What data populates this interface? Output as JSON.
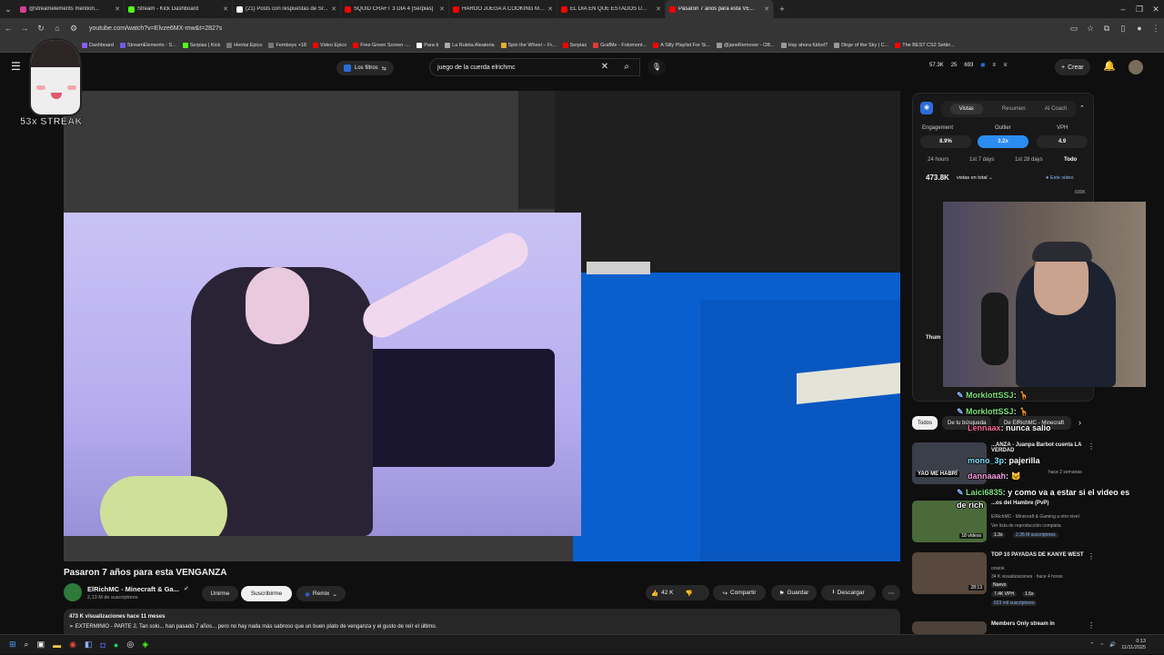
{
  "tabs": [
    {
      "label": "@streamelements mention...",
      "color": "#d63e8f",
      "active": false
    },
    {
      "label": "Stream - Kick Dashboard",
      "color": "#53fc18",
      "active": false
    },
    {
      "label": "(21) Posts con respuestas de Sr...",
      "color": "#ffffff",
      "active": false
    },
    {
      "label": "SQUID CRAFT 3 DIA 4 [Serpias]",
      "color": "#ff0000",
      "active": false
    },
    {
      "label": "HAROO JUEGA A COOKING MA...",
      "color": "#ff0000",
      "active": false
    },
    {
      "label": "EL DÍA EN QUE ESTADOS U...",
      "color": "#ff0000",
      "active": false
    },
    {
      "label": "Pasaron 7 años para esta VE...",
      "color": "#ff0000",
      "active": true
    }
  ],
  "address": {
    "url": "youtube.com/watch?v=Elvze6MX-mw&t=2827s"
  },
  "bookmarks": [
    "Dashboard",
    "StreamElements - S...",
    "Serpias | Kick",
    "Hentai Epico",
    "Femboys +18",
    "Video Epico",
    "Free Green Screen -...",
    "Para ti",
    "La Ruleta Aleatoria",
    "Spin the Wheel – Fr...",
    "Serpias",
    "GrafMe - Fotomont...",
    "A Silly Playlist For Si...",
    "@janeRemover - OB...",
    "Hay ahora fútbol?",
    "Dirge of the Sky | C...",
    "The BEST CS2 Settin..."
  ],
  "header": {
    "filters_label": "Los filtros",
    "search_value": "juego de la cuerda elrichmc",
    "stat1": "57.3K",
    "stat2": "25",
    "stat3": "693",
    "create_label": "Crear"
  },
  "streak": {
    "label": "53x STREAK"
  },
  "video": {
    "title": "Pasaron 7 años para esta VENGANZA",
    "channel": "ElRichMC - Minecraft & Ga...",
    "subs": "2,13 M de suscriptores",
    "join": "Unirme",
    "subscribe": "Suscribirme",
    "remix": "Remix",
    "likes": "42 K",
    "share": "Compartir",
    "save": "Guardar",
    "download": "Descargar",
    "desc_line1": "473 K visualizaciones  hace 11 meses",
    "desc_line2": "➢ EXTERMINIO - PARTE 2. Tan solo... han pasado 7 años... pero no hay nada más sabroso que un buen plato de venganza y el gusto de reír el último."
  },
  "ext": {
    "tabs": [
      "Vistas",
      "Resumen",
      "AI Coach"
    ],
    "metrics": [
      {
        "label": "Engagement",
        "value": "8.9%"
      },
      {
        "label": "Outlier",
        "value": "3.2x"
      },
      {
        "label": "VPH",
        "value": "4.9"
      }
    ],
    "periods": [
      "24 hours",
      "1st 7 days",
      "1st 28 days",
      "Todo"
    ],
    "views_total": "473.8K",
    "views_label": "vistas en total",
    "this_video": "Este video",
    "axis_top": "600K",
    "thumb_label": "Thum"
  },
  "chat": [
    {
      "user": "MorklottSSJ",
      "msg": ":"
    },
    {
      "user": "MorklottSSJ",
      "msg": ":"
    },
    {
      "user": "Lennaax",
      "msg": ": nunca salio"
    },
    {
      "user": "mono_3p",
      "msg": ": pajerilla"
    },
    {
      "user": "dannaaah",
      "msg": ":"
    },
    {
      "user": "Laici6835",
      "msg": ": y como va a estar si el video es"
    },
    {
      "user": "",
      "msg": "de rich"
    }
  ],
  "chips": [
    "Todos",
    "De tu búsqueda",
    "De ElRichMC - Minecraft"
  ],
  "related": [
    {
      "title": "...ANZA - Juanpa Barbot cuenta LA VERDAD",
      "meta": "hace 2 semanas",
      "badge": "YAO ME HABRÍ"
    },
    {
      "title": "...os del Hambre (PvP)",
      "meta": "ElRichMC - Minecraft & Gaming a otro nivel",
      "meta2": "Ver lista de reproducción completa",
      "badge": "18 vídeos",
      "pill1": "1.3x",
      "pill2": "2,35 M suscriptores"
    },
    {
      "title": "TOP 10 PAYADAS DE KANYE WEST",
      "meta": "onsiok",
      "meta2": "34 K visualizaciones · hace 4 horas",
      "badge": "28:13",
      "pill0": "Nuevo",
      "pill1": "7.4K VPH",
      "pill2": "1.5x",
      "pill3": "623 mil suscriptores"
    },
    {
      "title": "Members Only stream in",
      "meta": ""
    }
  ],
  "tray": {
    "time": "0:13",
    "date": "11/11/2025"
  }
}
